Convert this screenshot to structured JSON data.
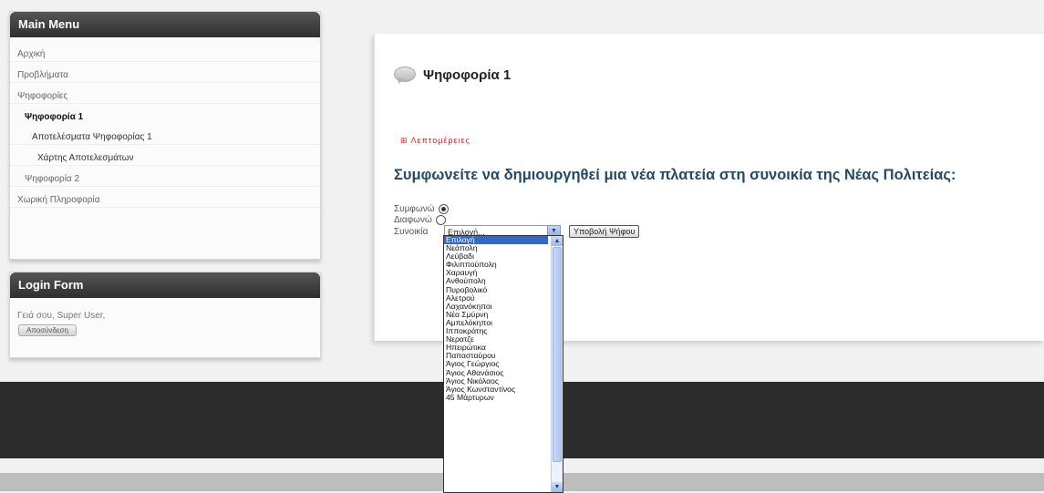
{
  "main_menu": {
    "title": "Main Menu",
    "items": [
      {
        "label": "Αρχική",
        "level": "top"
      },
      {
        "label": "Προβλήματα",
        "level": "top"
      },
      {
        "label": "Ψηφοφορίες",
        "level": "top"
      },
      {
        "label": "Ψηφοφορία 1",
        "level": "active"
      },
      {
        "label": "Αποτελέσματα Ψηφοφορίας 1",
        "level": "sub"
      },
      {
        "label": "Χάρτης Αποτελεσμάτων",
        "level": "sub2"
      },
      {
        "label": "Ψηφοφορία 2",
        "level": "sib"
      },
      {
        "label": "Χωρική Πληροφορία",
        "level": "top"
      }
    ]
  },
  "login_form": {
    "title": "Login Form",
    "greeting": "Γειά σου, Super User,",
    "logout_label": "Αποσύνδεση"
  },
  "poll": {
    "title": "Ψηφοφορία 1",
    "details_link": "⊞ Λεπτομέρειες",
    "question": "Συμφωνείτε να δημιουργηθεί μια νέα πλατεία στη συνοικία της Νέας Πολιτείας:",
    "option_agree": "Συμφωνώ",
    "option_disagree": "Διαφωνώ",
    "district_label": "Συνοικία",
    "district_selected": "Επιλογή...",
    "submit_label": "Υποβολή Ψήφου"
  },
  "district_options": [
    "Επιλογή",
    "Νεάπολη",
    "Λεύβαδι",
    "Φιλιππούπολη",
    "Χαραυγή",
    "Ανθούπολη",
    "Πυροβολικό",
    "Αλετρού",
    "Λαχανόκηποι",
    "Νέα Σμύρνη",
    "Αμπελόκηποι",
    "Ιπποκράτης",
    "Νερατζε",
    "Ηπειρώτικα",
    "Παπασταύρου",
    "Άγιος Γεώργιος",
    "Άγιος Αθανάσιος",
    "Άγιος Νικόλαος",
    "Άγιος Κωνσταντίνος",
    "45 Μάρτυρων"
  ],
  "footer": {
    "text": ""
  },
  "colors": {
    "accent": "#c0262c",
    "question": "#244a66",
    "selected": "#3169c6"
  },
  "icons": {
    "poll_title": "speech-bubble-icon",
    "select_arrow": "chevron-down-icon"
  }
}
